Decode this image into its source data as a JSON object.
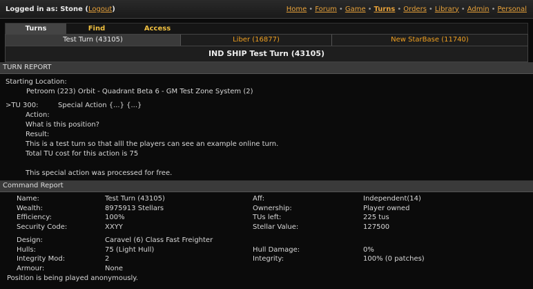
{
  "topbar": {
    "logged_in_prefix": "Logged in as: Stone",
    "logout": "Logout",
    "nav": [
      "Home",
      "Forum",
      "Game",
      "Turns",
      "Orders",
      "Library",
      "Admin",
      "Personal"
    ],
    "active_nav": "Turns"
  },
  "tabs": [
    "Turns",
    "Find",
    "Access"
  ],
  "subtabs": [
    "Test Turn (43105)",
    "Liber (16877)",
    "New StarBase (11740)"
  ],
  "page_title": "IND SHIP Test Turn (43105)",
  "turn_report": {
    "heading": "TURN REPORT",
    "starting_location_label": "Starting Location:",
    "starting_location": "Petroom (223) Orbit - Quadrant Beta 6 - GM Test Zone System (2)",
    "tu": ">TU 300:",
    "tu_action": "Special Action {...} {...}",
    "action_label": "Action:",
    "action_text": "What is this position?",
    "result_label": "Result:",
    "result_line1": "This is a test turn so that alll the players can see an example online turn.",
    "result_line2": "Total TU cost for this action is 75",
    "free_note": "This special action was processed for free."
  },
  "command_report": {
    "heading": "Command Report",
    "rows1": [
      [
        "Name:",
        "Test Turn (43105)",
        "Aff:",
        "Independent(14)"
      ],
      [
        "Wealth:",
        "8975913 Stellars",
        "Ownership:",
        "Player owned"
      ],
      [
        "Efficiency:",
        "100%",
        "TUs left:",
        "225 tus"
      ],
      [
        "Security Code:",
        "XXYY",
        "Stellar Value:",
        "127500"
      ]
    ],
    "rows2": [
      [
        "Design:",
        "Caravel (6) Class Fast Freighter",
        "",
        ""
      ],
      [
        "Hulls:",
        "75 (Light Hull)",
        "Hull Damage:",
        "0%"
      ],
      [
        "Integrity Mod:",
        "2",
        "Integrity:",
        "100% (0 patches)"
      ],
      [
        "Armour:",
        "None",
        "",
        ""
      ]
    ],
    "anon_note": "Position is being played anonymously."
  }
}
